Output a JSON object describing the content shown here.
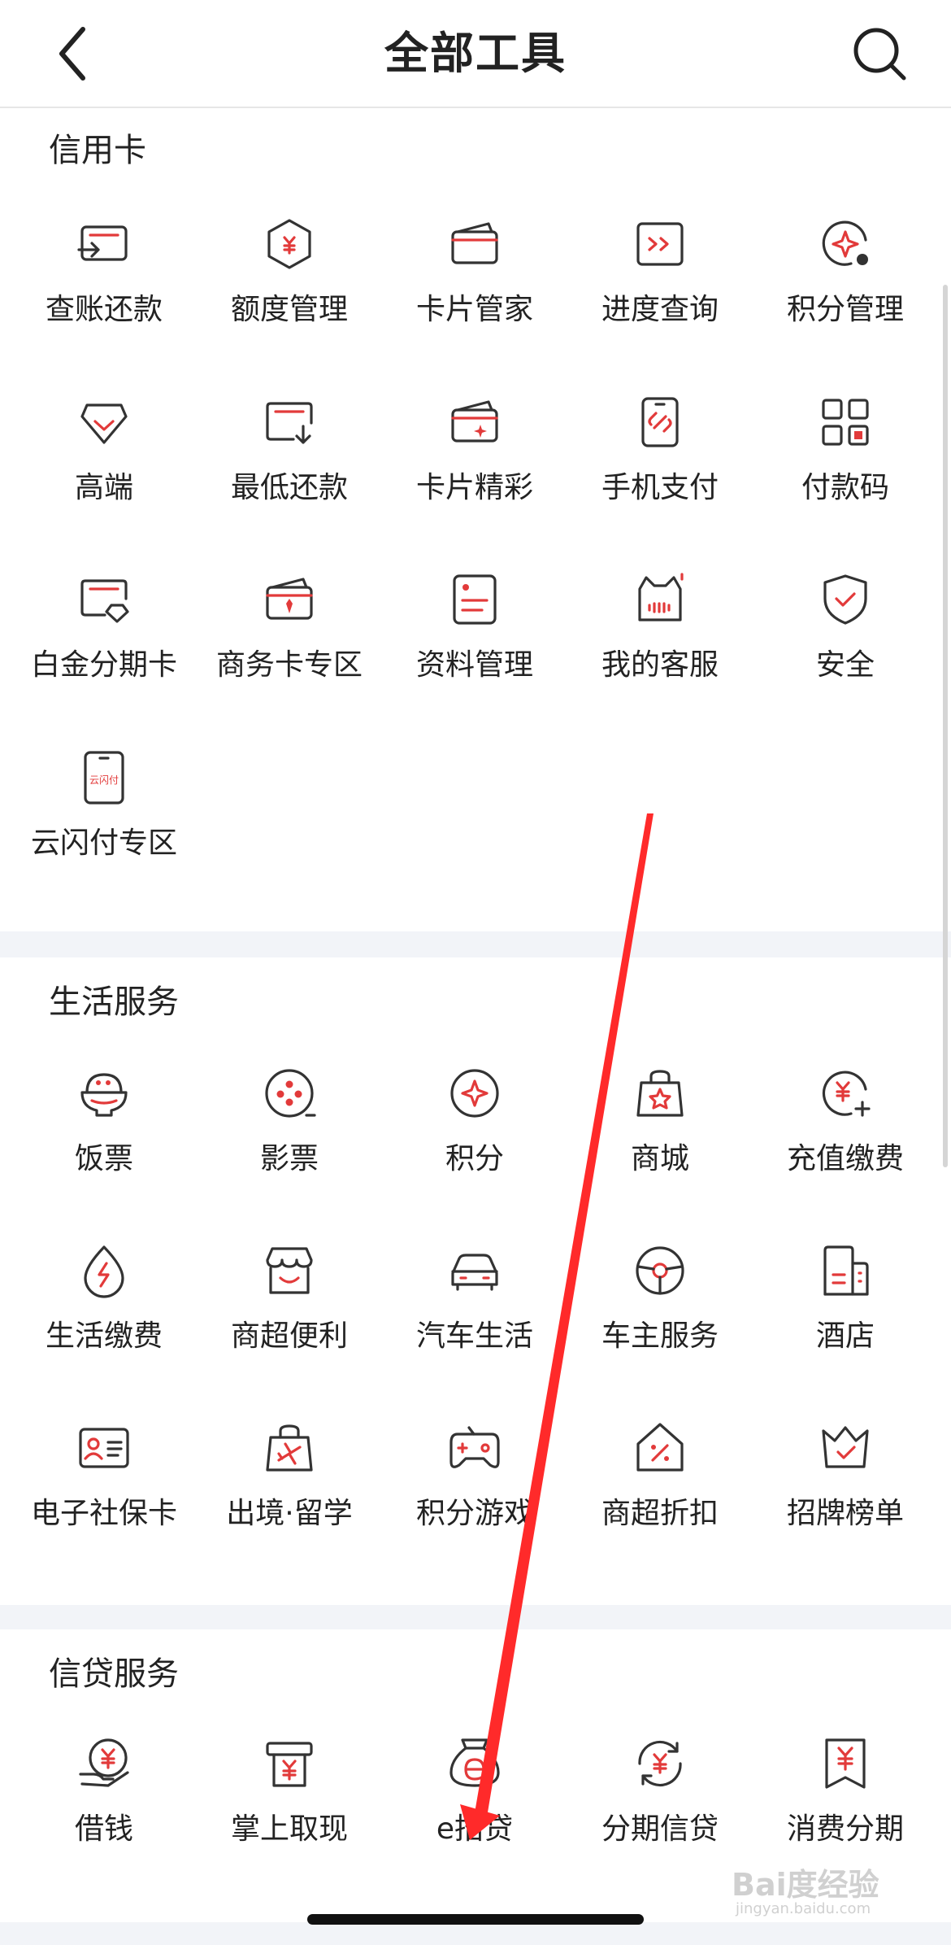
{
  "nav": {
    "title": "全部工具"
  },
  "sections": {
    "credit_card": {
      "title": "信用卡",
      "items": [
        "查账还款",
        "额度管理",
        "卡片管家",
        "进度查询",
        "积分管理",
        "高端",
        "最低还款",
        "卡片精彩",
        "手机支付",
        "付款码",
        "白金分期卡",
        "商务卡专区",
        "资料管理",
        "我的客服",
        "安全",
        "云闪付专区"
      ]
    },
    "life": {
      "title": "生活服务",
      "items": [
        "饭票",
        "影票",
        "积分",
        "商城",
        "充值缴费",
        "生活缴费",
        "商超便利",
        "汽车生活",
        "车主服务",
        "酒店",
        "电子社保卡",
        "出境·留学",
        "积分游戏",
        "商超折扣",
        "招牌榜单"
      ]
    },
    "loan": {
      "title": "信贷服务",
      "items": [
        "借钱",
        "掌上取现",
        "e招贷",
        "分期信贷",
        "消费分期"
      ]
    }
  },
  "icons": {
    "credit_card": [
      "bill-repay-icon",
      "credit-limit-icon",
      "card-manager-icon",
      "progress-query-icon",
      "points-manage-icon",
      "premium-diamond-icon",
      "min-repay-icon",
      "card-highlights-icon",
      "mobile-pay-icon",
      "qr-pay-code-icon",
      "platinum-card-icon",
      "business-card-icon",
      "profile-manage-icon",
      "customer-service-icon",
      "security-shield-icon",
      "unionpay-quickpass-icon"
    ],
    "life": [
      "meal-ticket-icon",
      "movie-ticket-icon",
      "points-icon",
      "mall-bag-icon",
      "recharge-icon",
      "utility-bill-icon",
      "convenience-store-icon",
      "car-life-icon",
      "car-owner-icon",
      "hotel-icon",
      "social-security-card-icon",
      "travel-study-icon",
      "points-game-icon",
      "supermarket-discount-icon",
      "ranking-crown-icon"
    ],
    "loan": [
      "borrow-money-icon",
      "cash-withdraw-icon",
      "e-loan-bag-icon",
      "installment-loan-icon",
      "consumer-installment-icon"
    ]
  },
  "colors": {
    "accent": "#e23a3a",
    "stroke": "#333333",
    "divider": "#f2f4f8"
  },
  "watermark": {
    "main": "Bai度经验",
    "sub": "jingyan.baidu.com"
  }
}
